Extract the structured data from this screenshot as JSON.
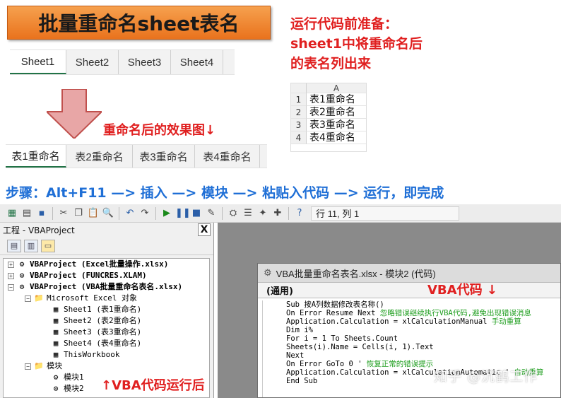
{
  "banner": {
    "title": "批量重命名sheet表名"
  },
  "prep_note": {
    "lines": [
      "运行代码前准备：",
      "sheet1中将重命名后",
      "的表名列出来"
    ]
  },
  "tabs_before": [
    "Sheet1",
    "Sheet2",
    "Sheet3",
    "Sheet4"
  ],
  "mini_sheet": {
    "column": "A",
    "rows": [
      {
        "n": "1",
        "value": "表1重命名"
      },
      {
        "n": "2",
        "value": "表2重命名"
      },
      {
        "n": "3",
        "value": "表3重命名"
      },
      {
        "n": "4",
        "value": "表4重命名"
      }
    ]
  },
  "effect_note": "重命名后的效果图↓",
  "tabs_after": [
    "表1重命名",
    "表2重命名",
    "表3重命名",
    "表4重命名"
  ],
  "steps": "步骤：Alt+F11 —> 插入 —> 模块 —> 粘贴入代码 —> 运行，即完成",
  "toolbar": {
    "cursor_position": "行 11, 列 1"
  },
  "project_pane": {
    "title": "工程 - VBAProject",
    "close": "X",
    "tree": [
      {
        "indent": 0,
        "toggle": "+",
        "icon": "⚙",
        "text": "VBAProject (Excel批量操作.xlsx)",
        "bold": true
      },
      {
        "indent": 0,
        "toggle": "+",
        "icon": "⚙",
        "text": "VBAProject (FUNCRES.XLAM)",
        "bold": true
      },
      {
        "indent": 0,
        "toggle": "−",
        "icon": "⚙",
        "text": "VBAProject (VBA批量重命名表名.xlsx)",
        "bold": true
      },
      {
        "indent": 1,
        "toggle": "−",
        "icon": "📁",
        "text": "Microsoft Excel 对象",
        "bold": false
      },
      {
        "indent": 2,
        "toggle": "",
        "icon": "▦",
        "text": "Sheet1 (表1重命名)",
        "bold": false
      },
      {
        "indent": 2,
        "toggle": "",
        "icon": "▦",
        "text": "Sheet2 (表2重命名)",
        "bold": false
      },
      {
        "indent": 2,
        "toggle": "",
        "icon": "▦",
        "text": "Sheet3 (表3重命名)",
        "bold": false
      },
      {
        "indent": 2,
        "toggle": "",
        "icon": "▦",
        "text": "Sheet4 (表4重命名)",
        "bold": false
      },
      {
        "indent": 2,
        "toggle": "",
        "icon": "▦",
        "text": "ThisWorkbook",
        "bold": false
      },
      {
        "indent": 1,
        "toggle": "−",
        "icon": "📁",
        "text": "模块",
        "bold": false
      },
      {
        "indent": 2,
        "toggle": "",
        "icon": "⚙",
        "text": "模块1",
        "bold": false
      },
      {
        "indent": 2,
        "toggle": "",
        "icon": "⚙",
        "text": "模块2",
        "bold": false
      }
    ]
  },
  "run_note": "↑VBA代码运行后",
  "code_window": {
    "title": "VBA批量重命名表名.xlsx - 模块2 (代码)",
    "object_combo": "(通用)",
    "vba_label": "VBA代码 ↓",
    "lines": [
      {
        "code": "Sub 按A列数据修改表名称()",
        "comment": ""
      },
      {
        "code": "On Error Resume Next",
        "comment": "忽略错误继续执行VBA代码,避免出现错误消息"
      },
      {
        "code": "Application.Calculation = xlCalculationManual",
        "comment": "手动重算"
      },
      {
        "code": "Dim i%",
        "comment": ""
      },
      {
        "code": "For i = 1 To Sheets.Count",
        "comment": ""
      },
      {
        "code": "Sheets(i).Name = Cells(i, 1).Text",
        "comment": ""
      },
      {
        "code": "Next",
        "comment": ""
      },
      {
        "code": "On Error GoTo 0 '",
        "comment": "恢复正常的错误提示"
      },
      {
        "code": "Application.Calculation = xlCalculationAutomatic '",
        "comment": "自动重算"
      },
      {
        "code": "End Sub",
        "comment": ""
      }
    ]
  },
  "watermark": "知乎 @沉鹤工作"
}
